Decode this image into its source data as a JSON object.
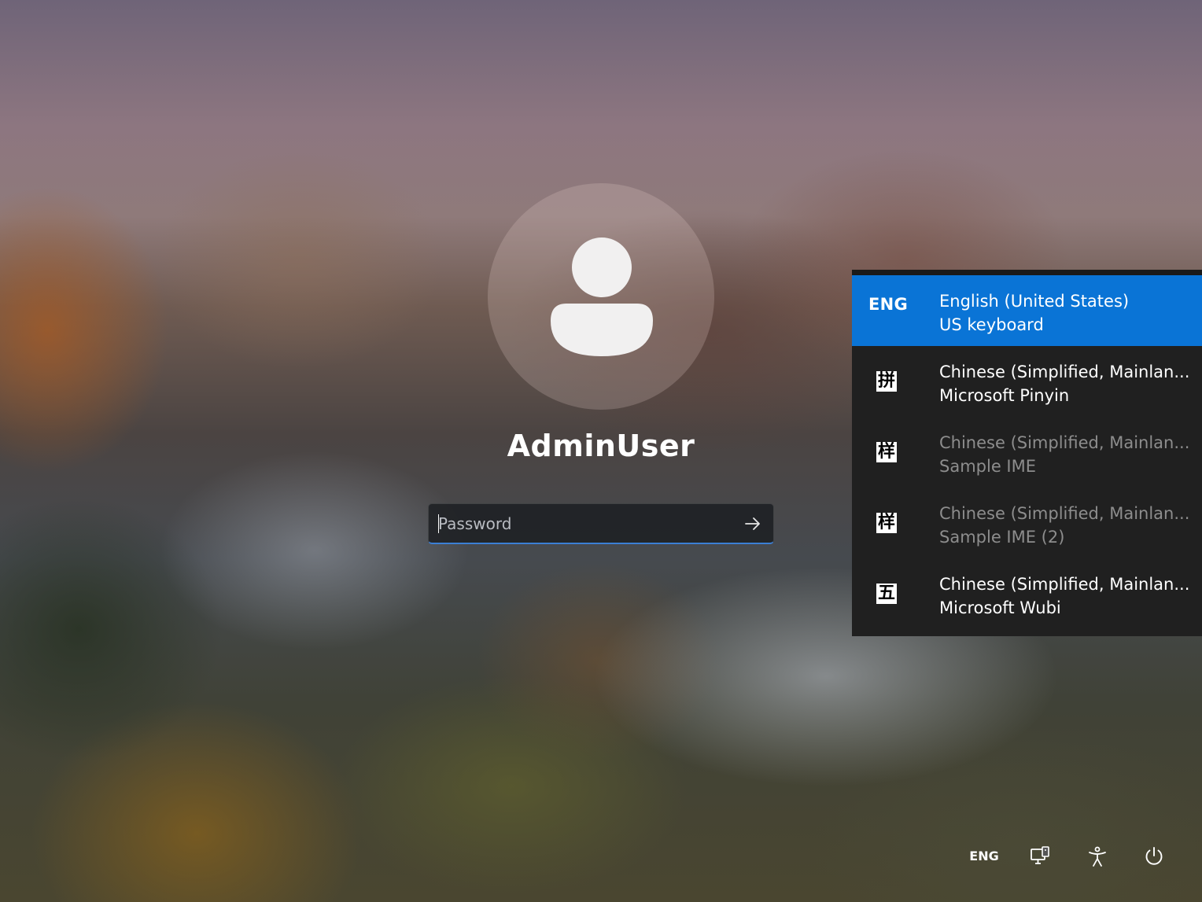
{
  "lock_screen": {
    "username": "AdminUser",
    "password": {
      "value": "",
      "placeholder": "Password",
      "submit_icon": "arrow-right-icon"
    }
  },
  "language_menu": {
    "items": [
      {
        "code": "ENG",
        "glyph": "",
        "name": "English (United States)",
        "method": "US keyboard",
        "selected": true,
        "enabled": true
      },
      {
        "code": "",
        "glyph": "拼",
        "name": "Chinese (Simplified, Mainlan...",
        "method": "Microsoft Pinyin",
        "selected": false,
        "enabled": true
      },
      {
        "code": "",
        "glyph": "样",
        "name": "Chinese (Simplified, Mainlan...",
        "method": "Sample IME",
        "selected": false,
        "enabled": false
      },
      {
        "code": "",
        "glyph": "样",
        "name": "Chinese (Simplified, Mainlan...",
        "method": "Sample IME (2)",
        "selected": false,
        "enabled": false
      },
      {
        "code": "",
        "glyph": "五",
        "name": "Chinese (Simplified, Mainlan...",
        "method": "Microsoft Wubi",
        "selected": false,
        "enabled": true
      }
    ]
  },
  "tray": {
    "language": "ENG",
    "icons": [
      "network-icon",
      "accessibility-icon",
      "power-icon"
    ]
  },
  "colors": {
    "accent": "#0a74d6",
    "menu_background": "#202020",
    "disabled_text": "#8d8d8d",
    "input_underline": "#3b7fd4"
  }
}
